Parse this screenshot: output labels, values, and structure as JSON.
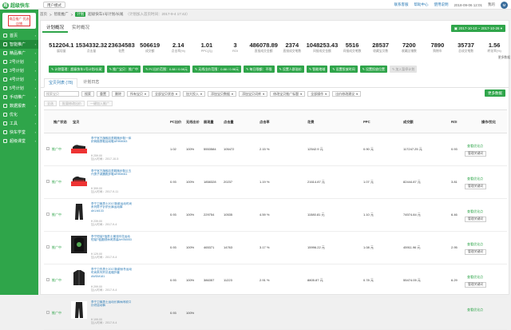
{
  "topbar": {
    "logo_mark": "超",
    "logo_text": "超级快车",
    "mode": "用户模式",
    "links": [
      "联系客服",
      "帮助中心",
      "使用说明"
    ],
    "date": "2018-09-06 12:01",
    "user_label": "我的",
    "avatar": "M"
  },
  "sidebar": {
    "shop_label": "商品推广\n优选店铺",
    "items": [
      {
        "label": "首页",
        "active": false
      },
      {
        "label": "智能推广",
        "active": true
      },
      {
        "label": "精品推广",
        "active": false
      },
      {
        "label": "2号计划",
        "active": false
      },
      {
        "label": "3号计划",
        "active": false
      },
      {
        "label": "4号计划",
        "active": false
      },
      {
        "label": "5号计划",
        "active": false
      },
      {
        "label": "手动推广",
        "active": false
      },
      {
        "label": "数据报表",
        "active": false
      },
      {
        "label": "优化",
        "active": false
      },
      {
        "label": "工具",
        "active": false
      },
      {
        "label": "快车学堂",
        "active": false
      },
      {
        "label": "超级课堂",
        "active": false
      }
    ]
  },
  "breadcrumb": {
    "items": [
      "首页",
      "智能推广"
    ],
    "badge": "计划",
    "current": "超级快车1号计划/长尾",
    "note": "（计划加入首页时间：2017-9-4 17:42）"
  },
  "tabs_top": [
    "计划概况",
    "实时概况"
  ],
  "date_range": "2017-10-10 ~ 2017-10-26",
  "stats": [
    {
      "value": "512204.1",
      "label": "展现量"
    },
    {
      "value": "1534332.32",
      "label": "点击量"
    },
    {
      "value": "23634583",
      "label": "花费"
    },
    {
      "value": "506619",
      "label": "成交额"
    },
    {
      "value": "2.14",
      "label": "点击率(%)"
    },
    {
      "value": "1.01",
      "label": "PPC(元)"
    },
    {
      "value": "3",
      "label": "ROI"
    },
    {
      "value": "486078.89",
      "label": "直接成交金额"
    },
    {
      "value": "2374",
      "label": "直接成交笔数"
    },
    {
      "value": "1048253.43",
      "label": "间接成交金额"
    },
    {
      "value": "5516",
      "label": "间接成交笔数"
    },
    {
      "value": "28537",
      "label": "收藏宝贝数"
    },
    {
      "value": "7200",
      "label": "收藏店铺数"
    },
    {
      "value": "7890",
      "label": "购物车"
    },
    {
      "value": "35737",
      "label": "总成交笔数"
    },
    {
      "value": "1.56",
      "label": "转化率(%)"
    }
  ],
  "stats_more": "更多数据",
  "actions": [
    "计划管理：超级快车1号计划/长尾",
    "推广宝贝：推广中",
    "PC出价范围：0.88 / 0.98元",
    "无线出价范围：0.88 / 0.98元",
    "每日限额：不限",
    "设置人群溢价",
    "智能地域",
    "设置投放时间",
    "设置投放位置",
    "加入暂停计划"
  ],
  "tabs_bottom": [
    "宝贝列表",
    "计划日志"
  ],
  "tabs_bottom_count": "(78)",
  "filters": {
    "search_placeholder": "搜索宝贝",
    "buttons": [
      "搜索",
      "重置",
      "删除"
    ],
    "selects": [
      "所有宝贝",
      "全部宝贝状态",
      "加大投入",
      "添加宝贝数据",
      "添加宝贝词库",
      "修改宝贝推广标题",
      "全部操作",
      "出价修改建议"
    ]
  },
  "batch_button": "更多数据",
  "select_bar": [
    "全选",
    "批量修改出价",
    "一键加入推广"
  ],
  "table_headers": [
    "推广状态",
    "宝贝",
    "PC出价",
    "无线出价",
    "展现量",
    "点击量",
    "点击率",
    "花费",
    "PPC",
    "成交额",
    "ROI",
    "操作/优化"
  ],
  "rows": [
    {
      "status": "推广中",
      "title": "李宁官方旗舰店男鞋跑步鞋一体织网面男鞋运动鞋ARHM063",
      "price": "¥ 259.00",
      "added": "加入时间：2017-10-5",
      "pc_bid": "1.02",
      "wireless": "100%",
      "impr": "5553584",
      "clicks": "105472",
      "ctr": "2.15 %",
      "cost": "12542.9 元",
      "ppc": "0.90 元",
      "sales": "117247.25 元",
      "roi": "0.93",
      "opt": "查看优化点",
      "opt_btn": "管理关键词",
      "img": "shoe-red"
    },
    {
      "status": "推广中",
      "title": "李宁官方旗舰店男鞋跑步鞋云五代男子减震跑步鞋ARHM061",
      "price": "¥ 399.00",
      "added": "加入时间：2017-9-11",
      "pc_bid": "0.93",
      "wireless": "100%",
      "impr": "1858328",
      "clicks": "20237",
      "ctr": "1.19 %",
      "cost": "21614.87 元",
      "ppc": "1.07 元",
      "sales": "82444.87 元",
      "roi": "3.81",
      "opt": "查看优化点",
      "opt_btn": "管理关键词",
      "img": "shoe-black"
    },
    {
      "status": "推广中",
      "title": "李宁卫裤男士2017新款运动时尚系列男子针织长裤运动裤AKLM133",
      "price": "¥ 239.00",
      "added": "加入时间：2017-9-4",
      "pc_bid": "0.93",
      "wireless": "100%",
      "impr": "229754",
      "clicks": "10535",
      "ctr": "4.59 %",
      "cost": "11580.81 元",
      "ppc": "1.10 元",
      "sales": "74574.84 元",
      "roi": "6.46",
      "opt": "查看优化点",
      "opt_btn": "管理关键词",
      "img": "pants"
    },
    {
      "status": "推广中",
      "title": "李宁短袖T恤男士潮流印花运动短袖T恤圆领休闲男装AHSM053",
      "price": "¥ 129.00",
      "added": "加入时间：2017-9-4",
      "pc_bid": "0.93",
      "wireless": "100%",
      "impr": "465371",
      "clicks": "14763",
      "ctr": "3.17 %",
      "cost": "15996.22 元",
      "ppc": "1.08 元",
      "sales": "45911.96 元",
      "roi": "2.95",
      "opt": "查看优化点",
      "opt_btn": "管理关键词",
      "img": "shirt"
    },
    {
      "status": "推广中",
      "title": "李宁卫衣男士2017新款秋冬运动时尚系列开衫连帽外套AWDM181",
      "price": "¥ 299.00",
      "added": "加入时间：2017-9-4",
      "pc_bid": "0.93",
      "wireless": "100%",
      "impr": "386357",
      "clicks": "11223",
      "ctr": "2.91 %",
      "cost": "8805.87 元",
      "ppc": "0.78 元",
      "sales": "55474.05 元",
      "roi": "6.29",
      "opt": "查看优化点",
      "opt_btn": "管理关键词",
      "img": "hoodie"
    },
    {
      "status": "推广中",
      "title": "李宁卫裤男士运动长裤休闲收口针织运动裤",
      "price": "¥ 199.00",
      "added": "加入时间：2017-9-4",
      "pc_bid": "0.93",
      "wireless": "100%",
      "impr": "",
      "clicks": "",
      "ctr": "",
      "cost": "",
      "ppc": "",
      "sales": "",
      "roi": "",
      "opt": "查看优化点",
      "opt_btn": "",
      "img": "pants"
    }
  ],
  "colors": {
    "brand": "#2fa54a",
    "link": "#2a7ab5"
  }
}
